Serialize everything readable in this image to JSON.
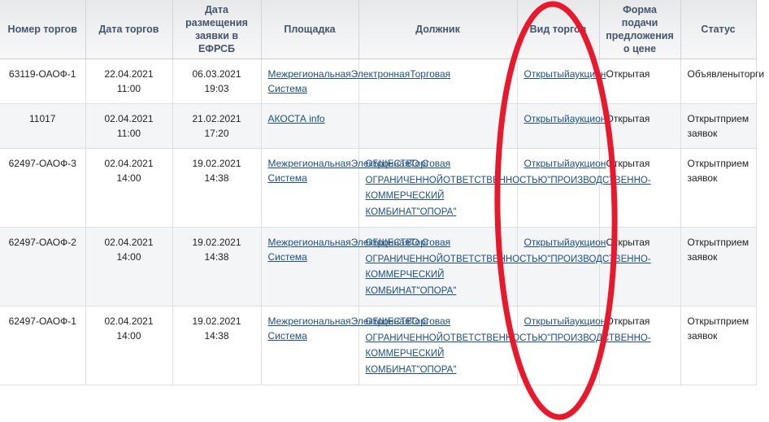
{
  "table": {
    "columns": [
      {
        "key": "number",
        "label": "Номер торгов"
      },
      {
        "key": "auction_date",
        "label": "Дата торгов"
      },
      {
        "key": "efrsb_date",
        "label": "Дата размещения заявки в ЕФРСБ"
      },
      {
        "key": "platform",
        "label": "Площадка"
      },
      {
        "key": "debtor",
        "label": "Должник"
      },
      {
        "key": "auction_type",
        "label": "Вид торгов"
      },
      {
        "key": "price_form",
        "label": "Форма подачи предложения о цене"
      },
      {
        "key": "status",
        "label": "Статус"
      }
    ],
    "header_labels": {
      "number": "Номер торгов",
      "auction_date": "Дата торгов",
      "efrsb_date_line1": "Дата размещения",
      "efrsb_date_line2": "заявки в ЕФРСБ",
      "platform": "Площадка",
      "debtor": "Должник",
      "auction_type": "Вид торгов",
      "price_form_line1": "Форма подачи",
      "price_form_line2": "предложения о",
      "price_form_line3": "цене",
      "status": "Статус"
    },
    "rows": [
      {
        "number": "63119-ОАОФ-1",
        "auction_date": "22.04.2021 11:00",
        "efrsb_date": "06.03.2021 19:03",
        "platform_lines": [
          "Межрегиональная",
          "Электронная",
          "Торговая Система"
        ],
        "debtor_lines": [],
        "auction_type_lines": [
          "Открытый",
          "аукцион"
        ],
        "price_form": "Открытая",
        "status_lines": [
          "Объявлены",
          "торги"
        ]
      },
      {
        "number": "11017",
        "auction_date": "02.04.2021 11:00",
        "efrsb_date": "21.02.2021 17:20",
        "platform_lines": [
          "АКОСТА info"
        ],
        "debtor_lines": [],
        "auction_type_lines": [
          "Открытый",
          "аукцион"
        ],
        "price_form": "Открытая",
        "status_lines": [
          "Открыт",
          "прием заявок"
        ]
      },
      {
        "number": "62497-ОАОФ-3",
        "auction_date": "02.04.2021 14:00",
        "efrsb_date": "19.02.2021 14:38",
        "platform_lines": [
          "Межрегиональная",
          "Электронная",
          "Торговая Система"
        ],
        "debtor_lines": [
          "ОБЩЕСТВО С ОГРАНИЧЕННОЙ",
          "ОТВЕТСТВЕННОСТЬЮ",
          "\"ПРОИЗВОДСТВЕННО-",
          "КОММЕРЧЕСКИЙ КОМБИНАТ",
          "\"ОПОРА\""
        ],
        "auction_type_lines": [
          "Открытый",
          "аукцион"
        ],
        "price_form": "Открытая",
        "status_lines": [
          "Открыт",
          "прием заявок"
        ]
      },
      {
        "number": "62497-ОАОФ-2",
        "auction_date": "02.04.2021 14:00",
        "efrsb_date": "19.02.2021 14:38",
        "platform_lines": [
          "Межрегиональная",
          "Электронная",
          "Торговая Система"
        ],
        "debtor_lines": [
          "ОБЩЕСТВО С ОГРАНИЧЕННОЙ",
          "ОТВЕТСТВЕННОСТЬЮ",
          "\"ПРОИЗВОДСТВЕННО-",
          "КОММЕРЧЕСКИЙ КОМБИНАТ",
          "\"ОПОРА\""
        ],
        "auction_type_lines": [
          "Открытый",
          "аукцион"
        ],
        "price_form": "Открытая",
        "status_lines": [
          "Открыт",
          "прием заявок"
        ]
      },
      {
        "number": "62497-ОАОФ-1",
        "auction_date": "02.04.2021 14:00",
        "efrsb_date": "19.02.2021 14:38",
        "platform_lines": [
          "Межрегиональная",
          "Электронная",
          "Торговая Система"
        ],
        "debtor_lines": [
          "ОБЩЕСТВО С ОГРАНИЧЕННОЙ",
          "ОТВЕТСТВЕННОСТЬЮ",
          "\"ПРОИЗВОДСТВЕННО-",
          "КОММЕРЧЕСКИЙ КОМБИНАТ",
          "\"ОПОРА\""
        ],
        "auction_type_lines": [
          "Открытый",
          "аукцион"
        ],
        "price_form": "Открытая",
        "status_lines": [
          "Открыт",
          "прием заявок"
        ]
      }
    ]
  },
  "annotation": {
    "shape": "ellipse",
    "color": "#e8192c",
    "target_column": "Вид торгов"
  },
  "colors": {
    "link": "#1c4f82",
    "header_text": "#44556b",
    "row_alt_bg": "#f4f5f7",
    "border": "#dddfe2",
    "annotation_red": "#e8192c"
  }
}
